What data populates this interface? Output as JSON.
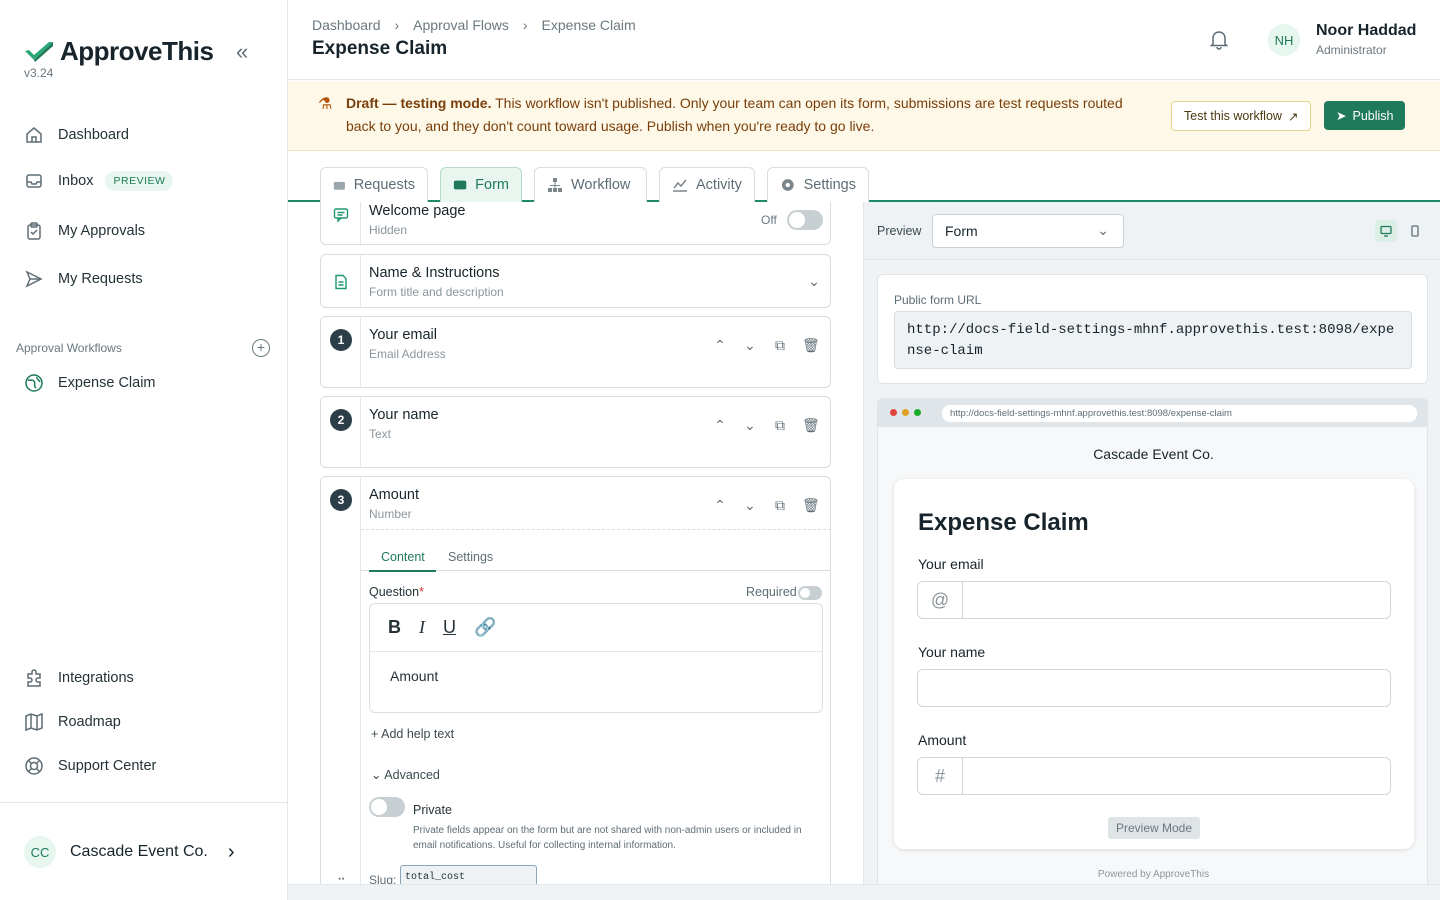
{
  "brand": {
    "name": "ApproveThis",
    "version": "v3.24"
  },
  "sidebar": {
    "nav": [
      {
        "label": "Dashboard",
        "icon": "home-icon"
      },
      {
        "label": "Inbox",
        "icon": "inbox-icon",
        "badge": "PREVIEW"
      },
      {
        "label": "My Approvals",
        "icon": "clipboard-icon"
      },
      {
        "label": "My Requests",
        "icon": "send-icon"
      }
    ],
    "section_title": "Approval Workflows",
    "workflow": {
      "label": "Expense Claim",
      "icon": "globe-icon"
    },
    "bottom": [
      {
        "label": "Integrations",
        "icon": "puzzle-icon"
      },
      {
        "label": "Roadmap",
        "icon": "map-icon"
      },
      {
        "label": "Support Center",
        "icon": "lifebuoy-icon"
      }
    ],
    "org": {
      "initials": "CC",
      "name": "Cascade Event Co."
    }
  },
  "header": {
    "breadcrumbs": [
      "Dashboard",
      "Approval Flows",
      "Expense Claim"
    ],
    "title": "Expense Claim",
    "user": {
      "initials": "NH",
      "name": "Noor Haddad",
      "role": "Administrator"
    }
  },
  "banner": {
    "lead": "Draft — testing mode.",
    "text": " This workflow isn't published. Only your team can open its form, submissions are test requests routed back to you, and they don't count toward usage. Publish when you're ready to go live.",
    "test_button": "Test this workflow",
    "publish_button": "Publish",
    "accent": "#1e7a5a"
  },
  "tabs": [
    "Requests",
    "Form",
    "Workflow",
    "Activity",
    "Settings"
  ],
  "active_tab": "Form",
  "editor": {
    "welcome": {
      "title": "Welcome page",
      "sub": "Hidden",
      "toggle": "Off"
    },
    "name_instructions": {
      "title": "Name & Instructions",
      "sub": "Form title and description"
    },
    "fields": [
      {
        "num": "1",
        "title": "Your email",
        "sub": "Email Address"
      },
      {
        "num": "2",
        "title": "Your name",
        "sub": "Text"
      },
      {
        "num": "3",
        "title": "Amount",
        "sub": "Number"
      }
    ],
    "subtabs": [
      "Content",
      "Settings"
    ],
    "question_label": "Question",
    "required_mark": "*",
    "required_label": "Required",
    "question_value": "Amount",
    "add_help": "Add help text",
    "advanced": "Advanced",
    "private_label": "Private",
    "private_help": "Private fields appear on the form but are not shared with non-admin users or included in email notifications. Useful for collecting internal information.",
    "slug_label": "Slug:",
    "slug_value": "total_cost"
  },
  "preview": {
    "label": "Preview",
    "select_value": "Form",
    "url_label": "Public form URL",
    "url": "http://docs-field-settings-mhnf.approvethis.test:8098/expense-claim",
    "browser_url": "http://docs-field-settings-mhnf.approvethis.test:8098/expense-claim",
    "company": "Cascade Event Co.",
    "form_title": "Expense Claim",
    "fields": [
      {
        "label": "Your email",
        "prefix": "@"
      },
      {
        "label": "Your name",
        "prefix": ""
      },
      {
        "label": "Amount",
        "prefix": "#"
      }
    ],
    "mode": "Preview Mode",
    "powered": "Powered by ApproveThis"
  }
}
